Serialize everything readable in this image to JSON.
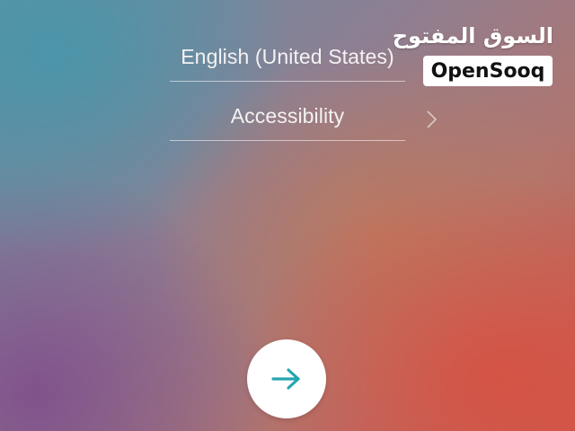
{
  "settings": {
    "language_label": "English (United States)",
    "accessibility_label": "Accessibility"
  },
  "watermark": {
    "arabic_text": "السوق المفتوح",
    "brand_text": "OpenSooq"
  },
  "icons": {
    "accessibility_chevron": "chevron-right-icon",
    "next_button": "arrow-right-icon"
  },
  "colors": {
    "accent": "#26a6b0",
    "text": "#f4f2f2"
  }
}
